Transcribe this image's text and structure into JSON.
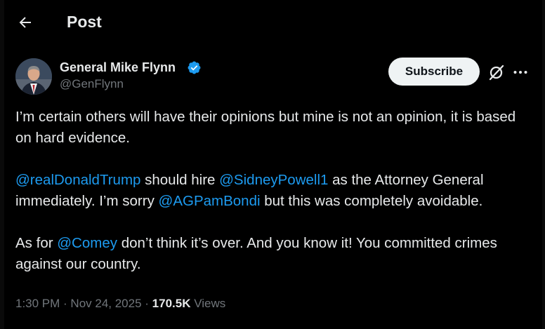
{
  "header": {
    "back_icon": "arrow-left-icon",
    "title": "Post"
  },
  "author": {
    "display_name": "General Mike Flynn",
    "handle": "@GenFlynn",
    "verified_icon": "verified-badge-icon",
    "verified_color": "#1d9bf0"
  },
  "actions": {
    "subscribe_label": "Subscribe",
    "grok_icon": "grok-icon",
    "more_icon": "more-horizontal-icon"
  },
  "post": {
    "p1": "I’m certain others will have their opinions but mine is not an opinion, it is based on hard evidence.",
    "p2_mention1": "@realDonaldTrump",
    "p2_text1": " should hire ",
    "p2_mention2": "@SidneyPowell1",
    "p2_text2": " as the Attorney General immediately. I’m sorry ",
    "p2_mention3": "@AGPamBondi",
    "p2_text3": " but this was completely avoidable.",
    "p3_text1": "As for ",
    "p3_mention1": "@Comey",
    "p3_text2": " don’t think it’s over. And you know it! You committed crimes against our country."
  },
  "meta": {
    "time": "1:30 PM",
    "sep1": " · ",
    "date": "Nov 24, 2025",
    "sep2": " · ",
    "views_count": "170.5K",
    "views_label": " Views"
  },
  "colors": {
    "background": "#000000",
    "text": "#e7e9ea",
    "muted": "#71767b",
    "link": "#1d9bf0"
  }
}
